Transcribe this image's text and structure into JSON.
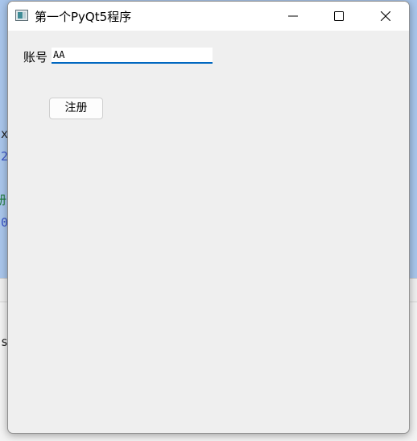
{
  "background": {
    "code_fragments": [
      "x",
      "2",
      "册",
      "0",
      "s"
    ]
  },
  "window": {
    "title": "第一个PyQt5程序",
    "icon": "app-window-icon",
    "controls": {
      "minimize": "minimize-icon",
      "maximize": "maximize-icon",
      "close": "close-icon"
    }
  },
  "form": {
    "account_label": "账号",
    "account_value": "AA",
    "register_label": "注册"
  },
  "colors": {
    "accent": "#0067c0",
    "window_bg": "#efefef",
    "desktop_bg": "#a9c6ec"
  }
}
